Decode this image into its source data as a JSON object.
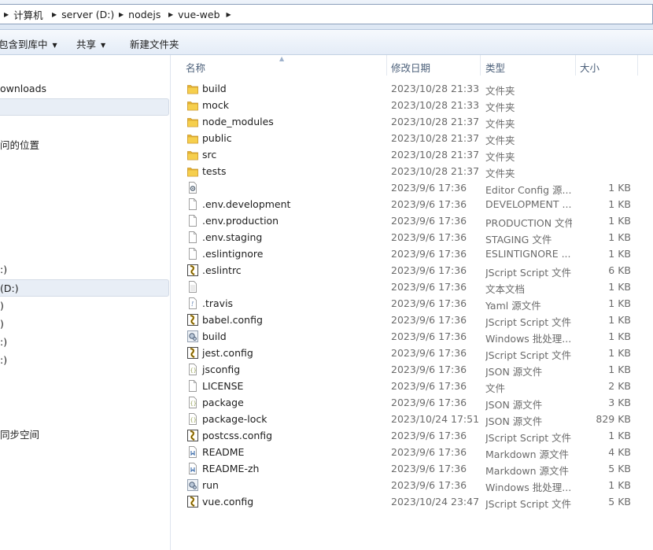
{
  "address_bar": {
    "crumbs": [
      "计算机",
      "server (D:)",
      "nodejs",
      "vue-web"
    ]
  },
  "toolbar": {
    "include_in_library": "包含到库中",
    "share": "共享",
    "new_folder": "新建文件夹"
  },
  "nav": {
    "items": [
      {
        "label": "ownloads",
        "selected": false
      },
      {
        "label": "",
        "selected": true
      },
      {
        "label": "问的位置",
        "selected": false
      },
      {
        "label": ":)",
        "selected": false
      },
      {
        "label": "(D:)",
        "selected": true
      },
      {
        "label": ")",
        "selected": false
      },
      {
        "label": ")",
        "selected": false
      },
      {
        "label": ":)",
        "selected": false
      },
      {
        "label": ":)",
        "selected": false
      },
      {
        "label": "同步空间",
        "selected": false
      }
    ]
  },
  "columns": {
    "name": "名称",
    "date": "修改日期",
    "type": "类型",
    "size": "大小"
  },
  "files": [
    {
      "name": "build",
      "date": "2023/10/28 21:33",
      "type": "文件夹",
      "size": "",
      "icon": "folder-icon"
    },
    {
      "name": "mock",
      "date": "2023/10/28 21:33",
      "type": "文件夹",
      "size": "",
      "icon": "folder-icon"
    },
    {
      "name": "node_modules",
      "date": "2023/10/28 21:37",
      "type": "文件夹",
      "size": "",
      "icon": "folder-icon"
    },
    {
      "name": "public",
      "date": "2023/10/28 21:37",
      "type": "文件夹",
      "size": "",
      "icon": "folder-icon"
    },
    {
      "name": "src",
      "date": "2023/10/28 21:37",
      "type": "文件夹",
      "size": "",
      "icon": "folder-icon"
    },
    {
      "name": "tests",
      "date": "2023/10/28 21:37",
      "type": "文件夹",
      "size": "",
      "icon": "folder-icon"
    },
    {
      "name": "",
      "date": "2023/9/6 17:36",
      "type": "Editor Config 源...",
      "size": "1 KB",
      "icon": "config-file-icon"
    },
    {
      "name": ".env.development",
      "date": "2023/9/6 17:36",
      "type": "DEVELOPMENT ...",
      "size": "1 KB",
      "icon": "blank-file-icon"
    },
    {
      "name": ".env.production",
      "date": "2023/9/6 17:36",
      "type": "PRODUCTION 文件",
      "size": "1 KB",
      "icon": "blank-file-icon"
    },
    {
      "name": ".env.staging",
      "date": "2023/9/6 17:36",
      "type": "STAGING 文件",
      "size": "1 KB",
      "icon": "blank-file-icon"
    },
    {
      "name": ".eslintignore",
      "date": "2023/9/6 17:36",
      "type": "ESLINTIGNORE ...",
      "size": "1 KB",
      "icon": "blank-file-icon"
    },
    {
      "name": ".eslintrc",
      "date": "2023/9/6 17:36",
      "type": "JScript Script 文件",
      "size": "6 KB",
      "icon": "jscript-file-icon"
    },
    {
      "name": "",
      "date": "2023/9/6 17:36",
      "type": "文本文档",
      "size": "1 KB",
      "icon": "text-file-icon"
    },
    {
      "name": ".travis",
      "date": "2023/9/6 17:36",
      "type": "Yaml 源文件",
      "size": "1 KB",
      "icon": "yaml-file-icon"
    },
    {
      "name": "babel.config",
      "date": "2023/9/6 17:36",
      "type": "JScript Script 文件",
      "size": "1 KB",
      "icon": "jscript-file-icon"
    },
    {
      "name": "build",
      "date": "2023/9/6 17:36",
      "type": "Windows 批处理...",
      "size": "1 KB",
      "icon": "batch-file-icon"
    },
    {
      "name": "jest.config",
      "date": "2023/9/6 17:36",
      "type": "JScript Script 文件",
      "size": "1 KB",
      "icon": "jscript-file-icon"
    },
    {
      "name": "jsconfig",
      "date": "2023/9/6 17:36",
      "type": "JSON 源文件",
      "size": "1 KB",
      "icon": "json-file-icon"
    },
    {
      "name": "LICENSE",
      "date": "2023/9/6 17:36",
      "type": "文件",
      "size": "2 KB",
      "icon": "blank-file-icon"
    },
    {
      "name": "package",
      "date": "2023/9/6 17:36",
      "type": "JSON 源文件",
      "size": "3 KB",
      "icon": "json-file-icon"
    },
    {
      "name": "package-lock",
      "date": "2023/10/24 17:51",
      "type": "JSON 源文件",
      "size": "829 KB",
      "icon": "json-file-icon"
    },
    {
      "name": "postcss.config",
      "date": "2023/9/6 17:36",
      "type": "JScript Script 文件",
      "size": "1 KB",
      "icon": "jscript-file-icon"
    },
    {
      "name": "README",
      "date": "2023/9/6 17:36",
      "type": "Markdown 源文件",
      "size": "4 KB",
      "icon": "markdown-file-icon"
    },
    {
      "name": "README-zh",
      "date": "2023/9/6 17:36",
      "type": "Markdown 源文件",
      "size": "5 KB",
      "icon": "markdown-file-icon"
    },
    {
      "name": "run",
      "date": "2023/9/6 17:36",
      "type": "Windows 批处理...",
      "size": "1 KB",
      "icon": "batch-file-icon"
    },
    {
      "name": "vue.config",
      "date": "2023/10/24 23:47",
      "type": "JScript Script 文件",
      "size": "5 KB",
      "icon": "jscript-file-icon"
    }
  ]
}
